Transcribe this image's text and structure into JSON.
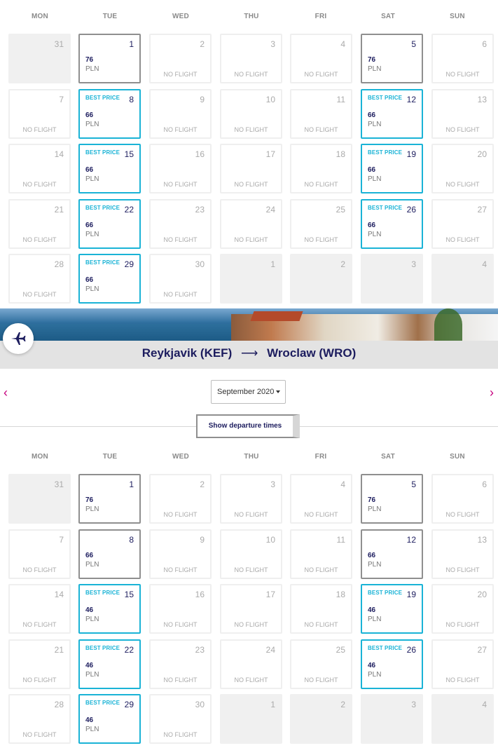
{
  "weekdays": [
    "MON",
    "TUE",
    "WED",
    "THU",
    "FRI",
    "SAT",
    "SUN"
  ],
  "labels": {
    "no_flight": "NO FLIGHT",
    "best_price": "BEST PRICE",
    "currency": "PLN"
  },
  "colors": {
    "navy": "#1c1c5e",
    "best_accent": "#1ab3d6",
    "chevron": "#c6007e"
  },
  "calendar_top": {
    "weeks": [
      [
        {
          "day": "31",
          "state": "empty"
        },
        {
          "day": "1",
          "state": "avail",
          "price": "76"
        },
        {
          "day": "2",
          "state": "none"
        },
        {
          "day": "3",
          "state": "none"
        },
        {
          "day": "4",
          "state": "none"
        },
        {
          "day": "5",
          "state": "avail",
          "price": "76"
        },
        {
          "day": "6",
          "state": "none"
        }
      ],
      [
        {
          "day": "7",
          "state": "none"
        },
        {
          "day": "8",
          "state": "best",
          "price": "66"
        },
        {
          "day": "9",
          "state": "none"
        },
        {
          "day": "10",
          "state": "none"
        },
        {
          "day": "11",
          "state": "none"
        },
        {
          "day": "12",
          "state": "best",
          "price": "66"
        },
        {
          "day": "13",
          "state": "none"
        }
      ],
      [
        {
          "day": "14",
          "state": "none"
        },
        {
          "day": "15",
          "state": "best",
          "price": "66"
        },
        {
          "day": "16",
          "state": "none"
        },
        {
          "day": "17",
          "state": "none"
        },
        {
          "day": "18",
          "state": "none"
        },
        {
          "day": "19",
          "state": "best",
          "price": "66"
        },
        {
          "day": "20",
          "state": "none"
        }
      ],
      [
        {
          "day": "21",
          "state": "none"
        },
        {
          "day": "22",
          "state": "best",
          "price": "66"
        },
        {
          "day": "23",
          "state": "none"
        },
        {
          "day": "24",
          "state": "none"
        },
        {
          "day": "25",
          "state": "none"
        },
        {
          "day": "26",
          "state": "best",
          "price": "66"
        },
        {
          "day": "27",
          "state": "none"
        }
      ],
      [
        {
          "day": "28",
          "state": "none"
        },
        {
          "day": "29",
          "state": "best",
          "price": "66"
        },
        {
          "day": "30",
          "state": "none"
        },
        {
          "day": "1",
          "state": "empty"
        },
        {
          "day": "2",
          "state": "empty"
        },
        {
          "day": "3",
          "state": "empty"
        },
        {
          "day": "4",
          "state": "empty"
        }
      ]
    ]
  },
  "route": {
    "origin": "Reykjavik (KEF)",
    "arrow": "⟶",
    "destination": "Wroclaw (WRO)",
    "icon": "plane-icon"
  },
  "month_select": {
    "value": "September 2020"
  },
  "show_departure_times": "Show departure times",
  "nav": {
    "prev": "‹",
    "next": "›"
  },
  "calendar_bottom": {
    "weeks": [
      [
        {
          "day": "31",
          "state": "empty"
        },
        {
          "day": "1",
          "state": "avail",
          "price": "76"
        },
        {
          "day": "2",
          "state": "none"
        },
        {
          "day": "3",
          "state": "none"
        },
        {
          "day": "4",
          "state": "none"
        },
        {
          "day": "5",
          "state": "avail",
          "price": "76"
        },
        {
          "day": "6",
          "state": "none"
        }
      ],
      [
        {
          "day": "7",
          "state": "none"
        },
        {
          "day": "8",
          "state": "avail",
          "price": "66"
        },
        {
          "day": "9",
          "state": "none"
        },
        {
          "day": "10",
          "state": "none"
        },
        {
          "day": "11",
          "state": "none"
        },
        {
          "day": "12",
          "state": "avail",
          "price": "66"
        },
        {
          "day": "13",
          "state": "none"
        }
      ],
      [
        {
          "day": "14",
          "state": "none"
        },
        {
          "day": "15",
          "state": "best",
          "price": "46"
        },
        {
          "day": "16",
          "state": "none"
        },
        {
          "day": "17",
          "state": "none"
        },
        {
          "day": "18",
          "state": "none"
        },
        {
          "day": "19",
          "state": "best",
          "price": "46"
        },
        {
          "day": "20",
          "state": "none"
        }
      ],
      [
        {
          "day": "21",
          "state": "none"
        },
        {
          "day": "22",
          "state": "best",
          "price": "46"
        },
        {
          "day": "23",
          "state": "none"
        },
        {
          "day": "24",
          "state": "none"
        },
        {
          "day": "25",
          "state": "none"
        },
        {
          "day": "26",
          "state": "best",
          "price": "46"
        },
        {
          "day": "27",
          "state": "none"
        }
      ],
      [
        {
          "day": "28",
          "state": "none"
        },
        {
          "day": "29",
          "state": "best",
          "price": "46"
        },
        {
          "day": "30",
          "state": "none"
        },
        {
          "day": "1",
          "state": "empty"
        },
        {
          "day": "2",
          "state": "empty"
        },
        {
          "day": "3",
          "state": "empty"
        },
        {
          "day": "4",
          "state": "empty"
        }
      ]
    ]
  }
}
